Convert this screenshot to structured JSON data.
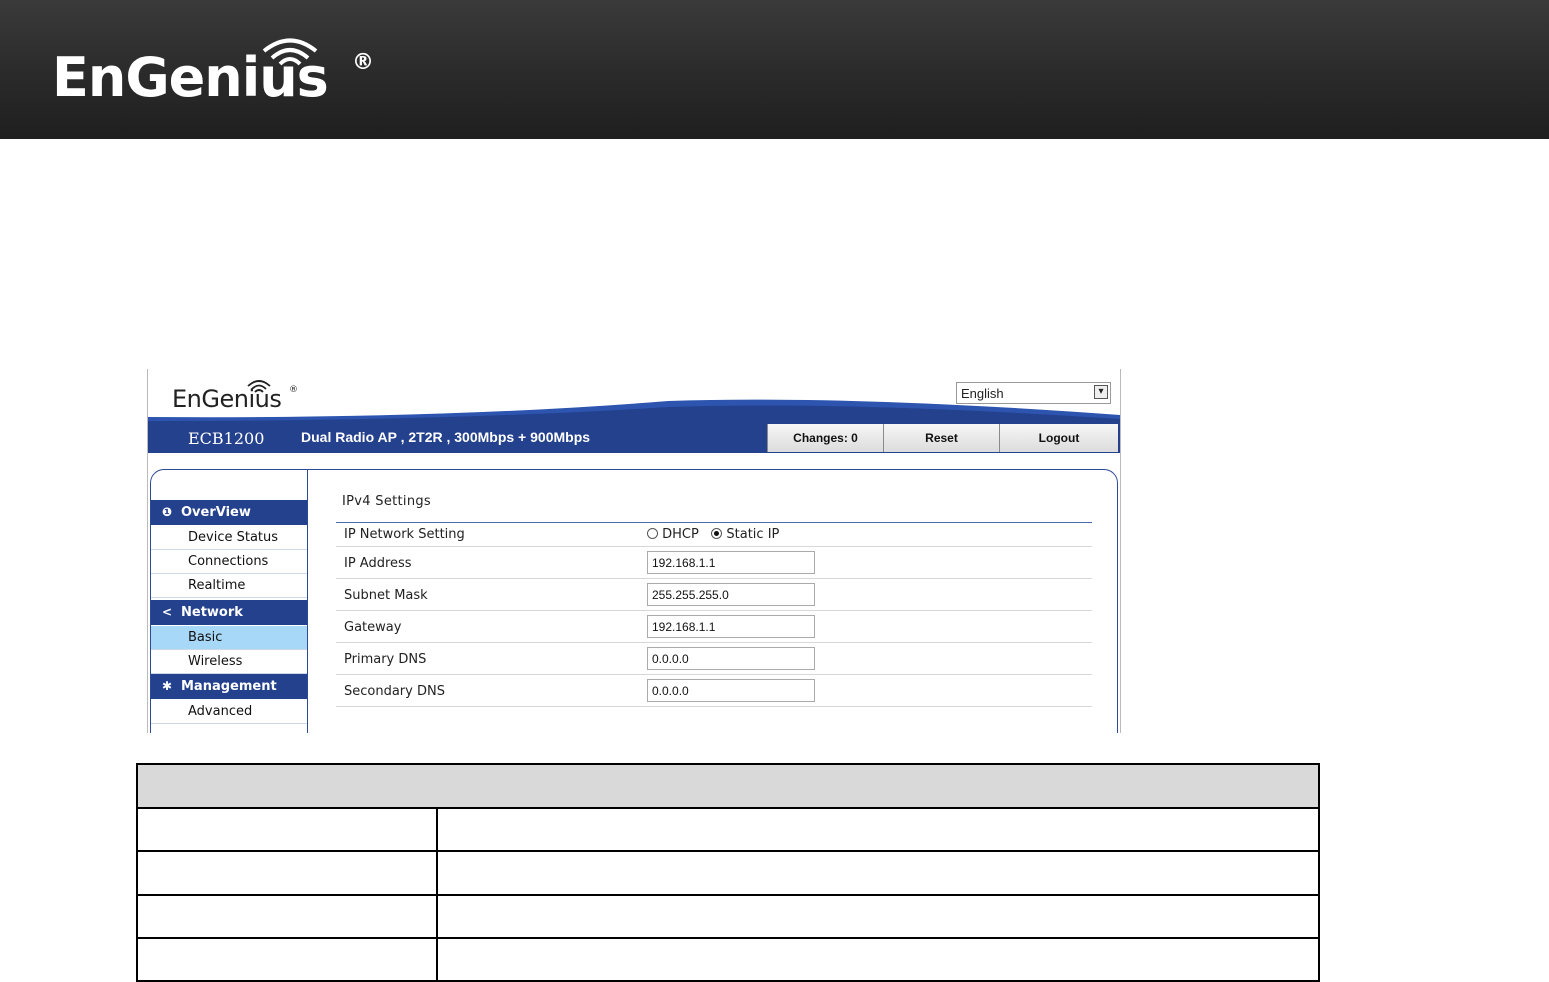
{
  "banner": {
    "brand": "EnGenius",
    "reg_mark": "®"
  },
  "app": {
    "logo_text": "EnGenius",
    "reg_mark": "®",
    "language": {
      "selected": "English"
    },
    "model": "ECB1200",
    "description": "Dual Radio AP , 2T2R , 300Mbps + 900Mbps",
    "header_buttons": {
      "changes": "Changes: 0",
      "reset": "Reset",
      "logout": "Logout"
    },
    "sidebar": {
      "overview": {
        "label": "OverView",
        "items": [
          "Device Status",
          "Connections",
          "Realtime"
        ]
      },
      "network": {
        "label": "Network",
        "items": [
          "Basic",
          "Wireless"
        ],
        "active": "Basic"
      },
      "management": {
        "label": "Management",
        "items": [
          "Advanced"
        ]
      }
    },
    "section_title": "IPv4 Settings",
    "fields": {
      "ip_network_setting": {
        "label": "IP Network Setting",
        "options": [
          "DHCP",
          "Static IP"
        ],
        "selected": "Static IP"
      },
      "ip_address": {
        "label": "IP Address",
        "value": "192.168.1.1"
      },
      "subnet_mask": {
        "label": "Subnet Mask",
        "value": "255.255.255.0"
      },
      "gateway": {
        "label": "Gateway",
        "value": "192.168.1.1"
      },
      "primary_dns": {
        "label": "Primary DNS",
        "value": "0.0.0.0"
      },
      "secondary_dns": {
        "label": "Secondary DNS",
        "value": "0.0.0.0"
      }
    }
  },
  "colors": {
    "brand_blue": "#24418e",
    "active_item": "#a8d8f8",
    "banner_dark": "#2a2a2a"
  }
}
